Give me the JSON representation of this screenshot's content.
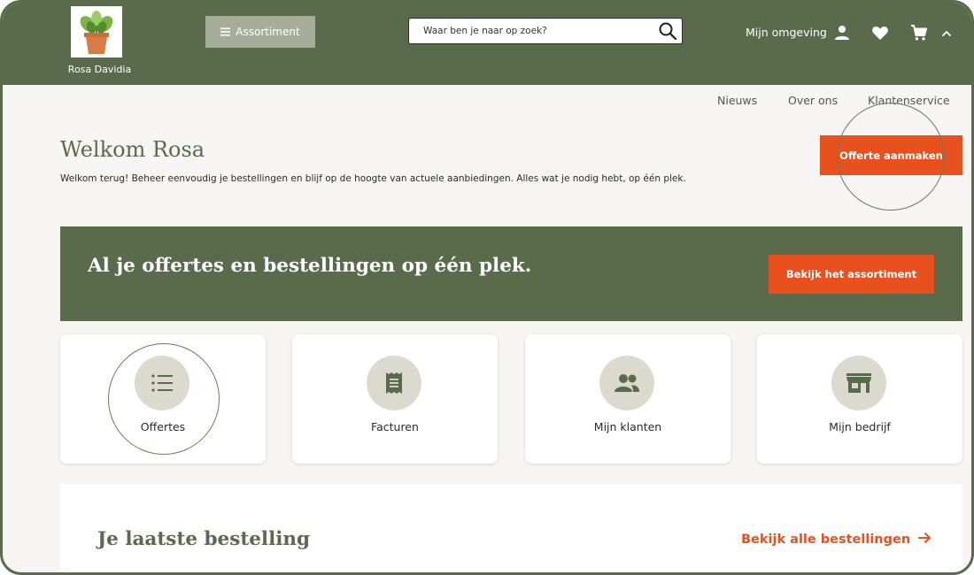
{
  "brand": {
    "name": "Rosa Davidia"
  },
  "header": {
    "assortment_label": "Assortiment",
    "search_placeholder": "Waar ben je naar op zoek?",
    "my_environment_label": "Mijn omgeving"
  },
  "subnav": {
    "items": [
      "Nieuws",
      "Over ons",
      "Klantenservice"
    ]
  },
  "welcome": {
    "title": "Welkom Rosa",
    "subtitle": "Welkom terug! Beheer eenvoudig je bestellingen en blijf op de hoogte van actuele aanbiedingen. Alles wat je nodig hebt, op één plek.",
    "cta_label": "Offerte aanmaken"
  },
  "banner": {
    "title": "Al je offertes en bestellingen op één plek.",
    "button_label": "Bekijk het assortiment"
  },
  "cards": [
    {
      "label": "Offertes",
      "icon": "list-icon"
    },
    {
      "label": "Facturen",
      "icon": "receipt-icon"
    },
    {
      "label": "Mijn klanten",
      "icon": "people-icon"
    },
    {
      "label": "Mijn bedrijf",
      "icon": "store-icon"
    }
  ],
  "latest_order": {
    "title": "Je laatste bestelling",
    "link_label": "Bekijk alle bestellingen"
  },
  "colors": {
    "primary": "#5a6b4c",
    "accent": "#e8501e",
    "icon_bg": "#dcd9cf"
  }
}
